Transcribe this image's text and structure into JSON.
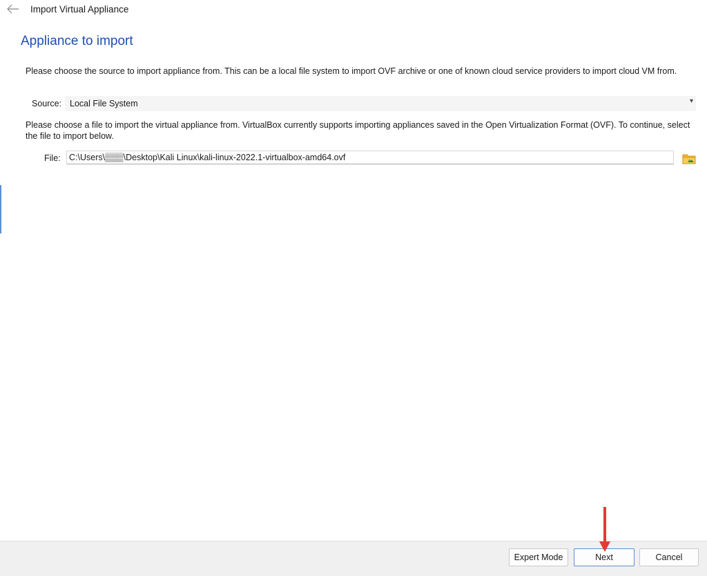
{
  "window": {
    "title": "Import Virtual Appliance",
    "back_icon": "arrow-left-icon"
  },
  "page": {
    "title": "Appliance to import",
    "source_description": "Please choose the source to import appliance from. This can be a local file system to import OVF archive or one of known cloud service providers to import cloud VM from.",
    "file_description": "Please choose a file to import the virtual appliance from. VirtualBox currently supports importing appliances saved in the Open Virtualization Format (OVF). To continue, select the file to import below."
  },
  "source": {
    "label": "Source:",
    "value": "Local File System"
  },
  "file": {
    "label": "File:",
    "value": "C:\\Users\\▒▒▒\\Desktop\\Kali Linux\\kali-linux-2022.1-virtualbox-amd64.ovf",
    "browse_icon": "folder-icon"
  },
  "buttons": {
    "expert_mode": "Expert Mode",
    "next": "Next",
    "cancel": "Cancel"
  },
  "colors": {
    "title_blue": "#1d4fb0",
    "annotation_red": "#e53935",
    "focus_blue": "#5b8fd1"
  }
}
